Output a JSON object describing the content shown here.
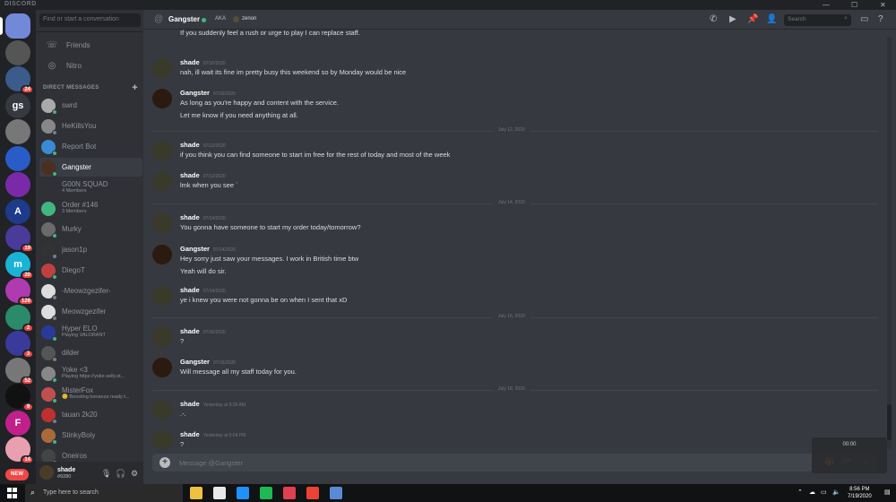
{
  "window": {
    "app_title": "DISCORD",
    "minimize_icon": "—",
    "maximize_icon": "☐",
    "close_icon": "✕"
  },
  "servers": [
    {
      "initials": "",
      "badge": "",
      "color": "#7289da"
    },
    {
      "initials": "",
      "badge": "",
      "color": "#555"
    },
    {
      "initials": "",
      "badge": "24",
      "color": "#3b5b8a"
    },
    {
      "initials": "gs",
      "badge": "",
      "color": "#36393f"
    },
    {
      "initials": "",
      "badge": "",
      "color": "#777"
    },
    {
      "initials": "",
      "badge": "",
      "color": "#2a5cc8"
    },
    {
      "initials": "",
      "badge": "",
      "color": "#7a2aa8"
    },
    {
      "initials": "A",
      "badge": "",
      "color": "#1e3a8a"
    },
    {
      "initials": "",
      "badge": "19",
      "color": "#4a3a9a"
    },
    {
      "initials": "m",
      "badge": "20",
      "color": "#1ab3d6"
    },
    {
      "initials": "",
      "badge": "126",
      "color": "#b03ab0"
    },
    {
      "initials": "",
      "badge": "2",
      "color": "#2a8a6a"
    },
    {
      "initials": "",
      "badge": "3",
      "color": "#3a3a9a"
    },
    {
      "initials": "",
      "badge": "52",
      "color": "#777"
    },
    {
      "initials": "",
      "badge": "9",
      "color": "#111"
    },
    {
      "initials": "F",
      "badge": "",
      "color": "#c0208a"
    },
    {
      "initials": "",
      "badge": "14",
      "color": "#e8a0b0"
    }
  ],
  "sidebar": {
    "search_placeholder": "Find or start a conversation",
    "friends_label": "Friends",
    "nitro_label": "Nitro",
    "dm_header": "DIRECT MESSAGES",
    "dm_add": "+",
    "dms": [
      {
        "name": "swrd",
        "sub": "",
        "color": "#aaa",
        "status": "#43b581"
      },
      {
        "name": "HeKillsYou",
        "sub": "",
        "color": "#888",
        "status": "#747f8d"
      },
      {
        "name": "Report Bot",
        "sub": "",
        "color": "#3a8ad6",
        "status": "#43b581"
      },
      {
        "name": "Gangster",
        "sub": "",
        "color": "#4a3020",
        "status": "#43b581"
      },
      {
        "name": "G00N SQUAD",
        "sub": "4 Members",
        "color": "#2f3136",
        "status": ""
      },
      {
        "name": "Order #146",
        "sub": "3 Members",
        "color": "#43b581",
        "status": ""
      },
      {
        "name": "Murky",
        "sub": "",
        "color": "#6a6a6a",
        "status": "#43b581"
      },
      {
        "name": "jason1p",
        "sub": "",
        "color": "#333",
        "status": "#747f8d"
      },
      {
        "name": "DiegoT",
        "sub": "",
        "color": "#c04040",
        "status": "#43b581"
      },
      {
        "name": "-Meowzgezifer-",
        "sub": "",
        "color": "#ddd",
        "status": "#747f8d"
      },
      {
        "name": "Meowzgezifer",
        "sub": "",
        "color": "#ddd",
        "status": "#747f8d"
      },
      {
        "name": "Hyper ELO",
        "sub": "Playing VALORANT",
        "color": "#2a3a9a",
        "status": "#43b581"
      },
      {
        "name": "dilder",
        "sub": "",
        "color": "#555",
        "status": "#747f8d"
      },
      {
        "name": "Yoke <3",
        "sub": "Playing https://yoke.selly.st...",
        "color": "#888",
        "status": "#43b581"
      },
      {
        "name": "MisterFox",
        "sub": "😊 Boosting bonanza ready t...",
        "color": "#c05050",
        "status": "#43b581"
      },
      {
        "name": "tauan 2k20",
        "sub": "",
        "color": "#c03030",
        "status": "#747f8d"
      },
      {
        "name": "StinkyBoiy",
        "sub": "",
        "color": "#aa6a3a",
        "status": "#43b581"
      },
      {
        "name": "Oneiros",
        "sub": "",
        "color": "#444",
        "status": "#747f8d"
      }
    ]
  },
  "user_panel": {
    "name": "shade",
    "tag": "#9280",
    "mic_icon": "🎙",
    "headphones_icon": "🎧",
    "settings_icon": "⚙"
  },
  "new_button_label": "NEW",
  "header": {
    "at_symbol": "@",
    "channel_name": "Gangster",
    "aka_label": "AKA",
    "aka_name": "zenon",
    "search_placeholder": "Search",
    "search_icon": "⌕",
    "call_icon": "✆",
    "video_icon": "▶",
    "pin_icon": "📌",
    "add_member_icon": "👤",
    "inbox_icon": "▭",
    "help_icon": "?"
  },
  "partial_top_line": "If you suddenly feel a rush or urge to play I can replace staff.",
  "messages": [
    {
      "author": "shade",
      "time": "07/10/2020",
      "lines": [
        "nah, ill wait its fine im pretty busy this weekend so by Monday would be nice"
      ],
      "av": "#3a3a2a"
    },
    {
      "author": "Gangster",
      "time": "07/10/2020",
      "lines": [
        "As long as you're happy and content with the service.",
        "Let me know if you need anything at all."
      ],
      "av": "#2a1a10"
    },
    {
      "author": "shade",
      "time": "07/12/2020",
      "lines": [
        "if you think you can find someone to start im free for  the rest of today and most of the week"
      ],
      "av": "#3a3a2a"
    },
    {
      "author": "shade",
      "time": "07/12/2020",
      "lines": [
        "lmk when you see `"
      ],
      "av": "#3a3a2a"
    },
    {
      "author": "shade",
      "time": "07/14/2020",
      "lines": [
        "You gonna have someone to start my order today/tomorrow?"
      ],
      "av": "#3a3a2a"
    },
    {
      "author": "Gangster",
      "time": "07/14/2020",
      "lines": [
        "Hey sorry just saw your messages. I work in British time btw",
        "Yeah will do sir."
      ],
      "av": "#2a1a10"
    },
    {
      "author": "shade",
      "time": "07/14/2020",
      "lines": [
        "ye i knew you were not gonna be on when I sent that xD"
      ],
      "av": "#3a3a2a"
    },
    {
      "author": "shade",
      "time": "07/16/2020",
      "lines": [
        "?"
      ],
      "av": "#3a3a2a"
    },
    {
      "author": "Gangster",
      "time": "07/16/2020",
      "lines": [
        "Will message all my staff today for you."
      ],
      "av": "#2a1a10"
    },
    {
      "author": "shade",
      "time": "Yesterday at 9:30 AM",
      "lines": [
        ".-."
      ],
      "av": "#3a3a2a"
    },
    {
      "author": "shade",
      "time": "Yesterday at 5:04 PM",
      "lines": [
        "?"
      ],
      "av": "#3a3a2a"
    }
  ],
  "dividers": [
    "July 12, 2020",
    "July 14, 2020",
    "July 16, 2020",
    "July 18, 2020"
  ],
  "composer": {
    "add_icon": "+",
    "placeholder": "Message @Gangster",
    "gift_icon": "🎁",
    "gif_icon": "GIF",
    "emoji_icon": "☺"
  },
  "recording_overlay": {
    "time": "00:00"
  },
  "taskbar": {
    "search_placeholder": "Type here to search",
    "search_icon": "⌕",
    "time": "8:56 PM",
    "date": "7/19/2020",
    "apps": [
      "#f0c040",
      "#e8e8e8",
      "#1e90ff",
      "#1db954",
      "#e04050",
      "#ea4335",
      "#5a8ad6"
    ]
  }
}
